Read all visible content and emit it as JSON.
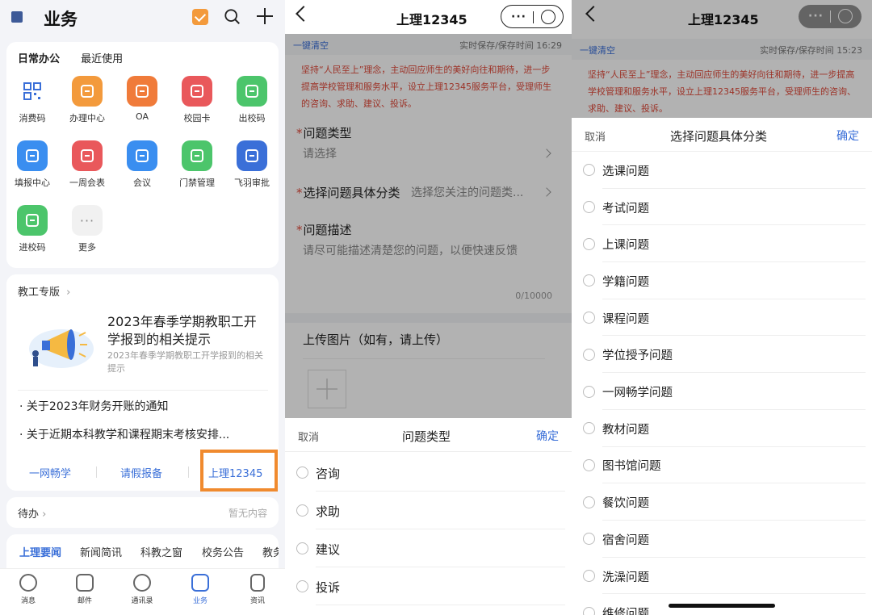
{
  "panel1": {
    "title": "业务",
    "section_tabs": [
      "日常办公",
      "最近使用"
    ],
    "apps": [
      {
        "label": "消费码",
        "icon": "qr-code-icon",
        "color": "#ffffff"
      },
      {
        "label": "办理中心",
        "icon": "building-icon",
        "color": "#f39a3c"
      },
      {
        "label": "OA",
        "icon": "oa-network-icon",
        "color": "#f07b3a"
      },
      {
        "label": "校园卡",
        "icon": "campus-card-icon",
        "color": "#e9585b"
      },
      {
        "label": "出校码",
        "icon": "exit-code-icon",
        "color": "#4cc56b"
      },
      {
        "label": "填报中心",
        "icon": "form-fill-icon",
        "color": "#3a8ef0"
      },
      {
        "label": "一周会表",
        "icon": "meeting-schedule-icon",
        "color": "#e9585b"
      },
      {
        "label": "会议",
        "icon": "video-meeting-icon",
        "color": "#3a8ef0"
      },
      {
        "label": "门禁管理",
        "icon": "tag-icon",
        "color": "#4cc56b"
      },
      {
        "label": "飞羽审批",
        "icon": "feather-icon",
        "color": "#3a6fd8"
      },
      {
        "label": "进校码",
        "icon": "entry-tag-icon",
        "color": "#4cc56b"
      },
      {
        "label": "更多",
        "icon": "more-dots-icon",
        "color": "#f1f1f1"
      }
    ],
    "teach_section": "教工专版",
    "promo_title": "2023年春季学期教职工开学报到的相关提示",
    "promo_sub": "2023年春季学期教职工开学报到的相关提示",
    "news": [
      "关于2023年财务开账的通知",
      "关于近期本科教学和课程期末考核安排..."
    ],
    "quick_links": [
      "一网畅学",
      "请假报备",
      "上理12345"
    ],
    "todo_label": "待办",
    "todo_empty": "暂无内容",
    "news_tabs": [
      "上理要闻",
      "新闻简讯",
      "科教之窗",
      "校务公告",
      "教务"
    ],
    "bottom_nav": [
      "消息",
      "邮件",
      "通讯录",
      "业务",
      "资讯"
    ]
  },
  "panel2": {
    "title": "上理12345",
    "clear": "一键清空",
    "save_time": "实时保存/保存时间 16:29",
    "notice": "坚持“人民至上”理念，主动回应师生的美好向往和期待，进一步提高学校管理和服务水平，设立上理12345服务平台，受理师生的咨询、求助、建议、投诉。",
    "req_mark": "*",
    "field_type_label": "问题类型",
    "field_type_value": "请选择",
    "field_cat_label": "选择问题具体分类",
    "field_cat_value": "选择您关注的问题类...",
    "field_desc_label": "问题描述",
    "field_desc_placeholder": "请尽可能描述清楚您的问题，以便快速反馈",
    "counter": "0/10000",
    "upload_label": "上传图片（如有，请上传）",
    "sheet_cancel": "取消",
    "sheet_title": "问题类型",
    "sheet_ok": "确定",
    "options": [
      "咨询",
      "求助",
      "建议",
      "投诉"
    ]
  },
  "panel3": {
    "title": "上理12345",
    "clear": "一键清空",
    "save_time": "实时保存/保存时间 15:23",
    "notice": "坚持“人民至上”理念，主动回应师生的美好向往和期待，进一步提高学校管理和服务水平，设立上理12345服务平台，受理师生的咨询、求助、建议、投诉。",
    "sheet_cancel": "取消",
    "sheet_title": "选择问题具体分类",
    "sheet_ok": "确定",
    "options": [
      "选课问题",
      "考试问题",
      "上课问题",
      "学籍问题",
      "课程问题",
      "学位授予问题",
      "一网畅学问题",
      "教材问题",
      "图书馆问题",
      "餐饮问题",
      "宿舍问题",
      "洗澡问题",
      "维修问题"
    ]
  }
}
